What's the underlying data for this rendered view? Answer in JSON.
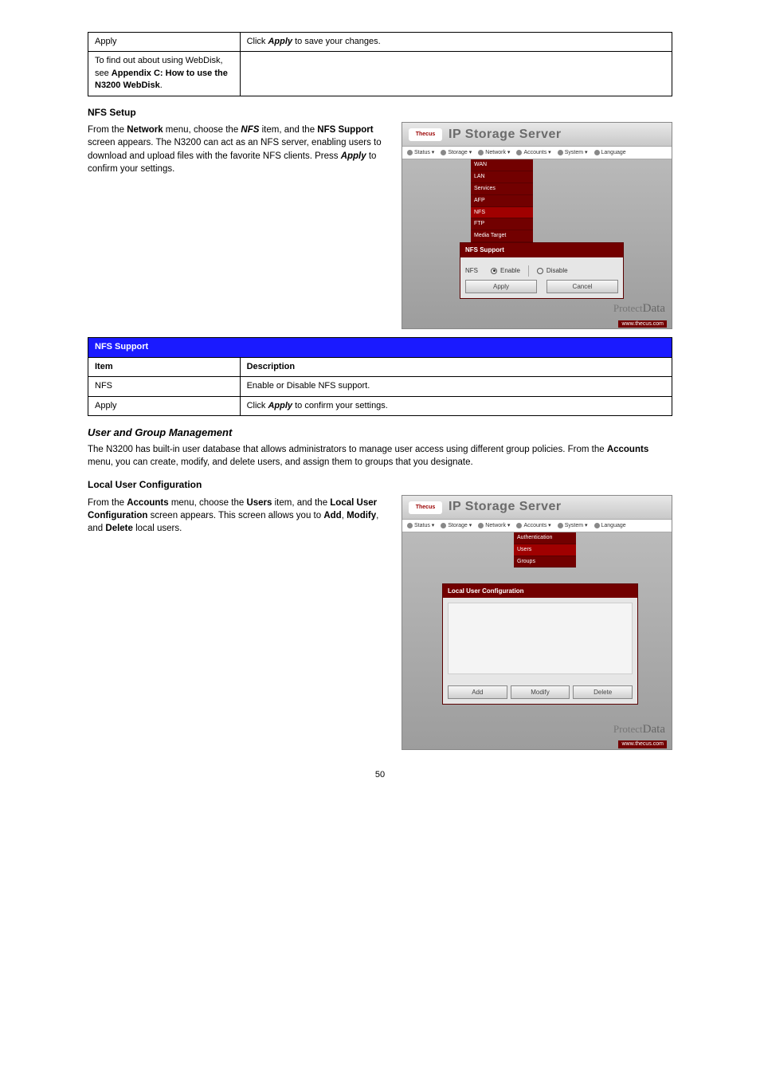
{
  "top_table": {
    "rows": [
      {
        "label": "Apply",
        "desc": "Click Apply to save your changes."
      },
      {
        "label": "To find out about using WebDisk, see Appendix C: How to use the N3200 WebDisk.",
        "desc": ""
      }
    ]
  },
  "nfs": {
    "heading": "NFS Setup",
    "intro1": "From the ",
    "menu1": "Network",
    "intro2": " menu, choose the ",
    "item1": "NFS",
    "intro3": " item, and the ",
    "screen1": "NFS Support",
    "intro4": " screen appears. The N3200 can act as an NFS server, enabling users to download and upload files with the favorite NFS clients. Press ",
    "apply": "Apply",
    "intro5": " to confirm your settings.",
    "table_title": "NFS Support",
    "table_item": "Item",
    "table_desc": "Description",
    "rows": [
      {
        "label": "NFS",
        "desc": "Enable or Disable NFS support."
      },
      {
        "label": "Apply",
        "desc": "Click Apply to confirm your settings."
      }
    ]
  },
  "accounts": {
    "heading": "User and Group Management",
    "para": "The N3200 has built-in user database that allows administrators to manage user access using different group policies. From the Accounts menu, you can create, modify, and delete users, and assign them to groups that you designate."
  },
  "local_user": {
    "heading": "Local User Configuration",
    "intro1": "From the ",
    "menu1": "Accounts",
    "intro2": " menu, choose the ",
    "item1": "Users",
    "intro3": " item, and the ",
    "screen1": "Local User Configuration",
    "intro4": " screen appears. This screen allows you to ",
    "b1": "Add",
    "intro5": ", ",
    "b2": "Modify",
    "intro6": ", and ",
    "b3": "Delete",
    "intro7": " local users."
  },
  "shot_common": {
    "brand": "Thecus",
    "banner": "IP Storage Server",
    "menu": [
      "Status ▾",
      "Storage ▾",
      "Network ▾",
      "Accounts ▾",
      "System ▾",
      "Language"
    ],
    "footer_brand": "Protect",
    "footer_brand2": "Data",
    "footer_link": "www.thecus.com"
  },
  "shot1": {
    "dropdown": [
      "WAN",
      "LAN",
      "Services",
      "AFP",
      "NFS",
      "FTP",
      "Media Target"
    ],
    "dd_selected": "NFS",
    "panel_title": "NFS Support",
    "radio_label": "NFS",
    "radio_enable": "Enable",
    "radio_disable": "Disable",
    "btn_apply": "Apply",
    "btn_cancel": "Cancel"
  },
  "shot2": {
    "dropdown": [
      "Authentication",
      "Users",
      "Groups"
    ],
    "dd_selected": "Users",
    "panel_title": "Local User Configuration",
    "btn_add": "Add",
    "btn_modify": "Modify",
    "btn_delete": "Delete"
  },
  "page_number": "50"
}
